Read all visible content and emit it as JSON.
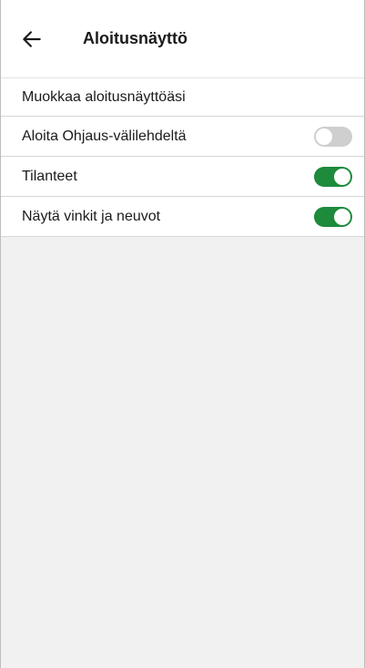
{
  "header": {
    "back_icon": "arrow-left-icon",
    "title": "Aloitusnäyttö"
  },
  "section": {
    "label": "Muokkaa aloitusnäyttöäsi"
  },
  "settings": [
    {
      "label": "Aloita Ohjaus-välilehdeltä",
      "enabled": false
    },
    {
      "label": "Tilanteet",
      "enabled": true
    },
    {
      "label": "Näytä vinkit ja neuvot",
      "enabled": true
    }
  ],
  "colors": {
    "toggle_on": "#1e8a3c",
    "toggle_off": "#cfcfcf",
    "background": "#f1f1f1"
  }
}
